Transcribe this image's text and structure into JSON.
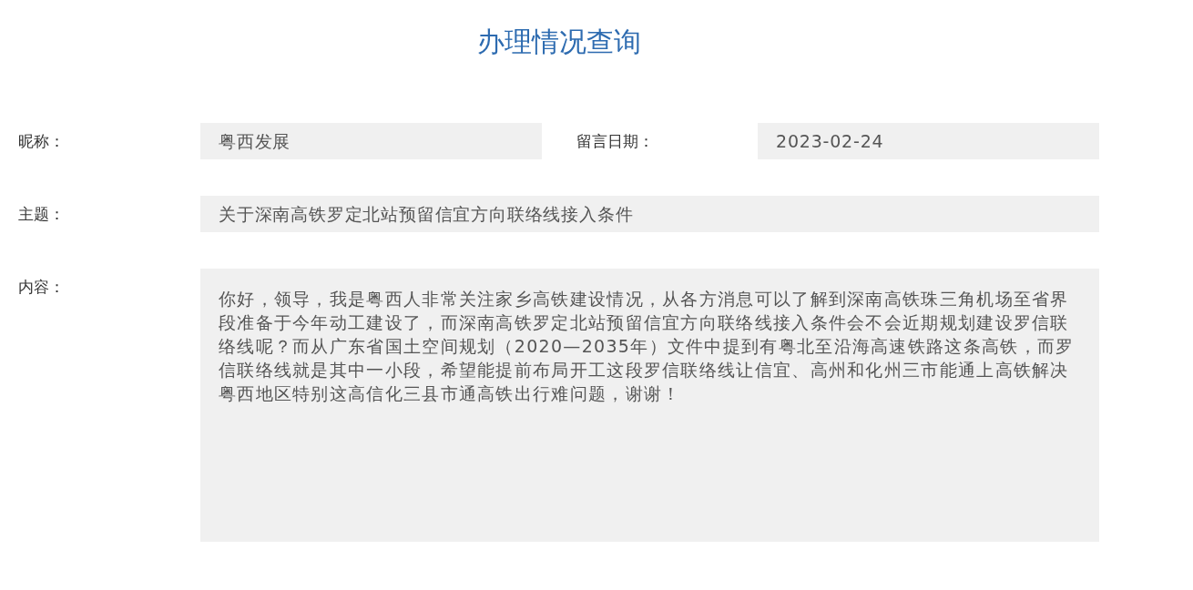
{
  "title": "办理情况查询",
  "rows": [
    {
      "fields": [
        {
          "kind": "line",
          "label": "昵称：",
          "value": "粤西发展"
        },
        {
          "kind": "line",
          "label": "留言日期：",
          "value": "2023-02-24"
        }
      ]
    },
    {
      "fields": [
        {
          "kind": "line",
          "label": "主题：",
          "value": "关于深南高铁罗定北站预留信宜方向联络线接入条件"
        }
      ]
    },
    {
      "fields": [
        {
          "kind": "area",
          "label": "内容：",
          "value": "你好，领导，我是粤西人非常关注家乡高铁建设情况，从各方消息可以了解到深南高铁珠三角机场至省界段准备于今年动工建设了，而深南高铁罗定北站预留信宜方向联络线接入条件会不会近期规划建设罗信联络线呢？而从广东省国土空间规划（2020—2035年）文件中提到有粤北至沿海高速铁路这条高铁，而罗信联络线就是其中一小段，希望能提前布局开工这段罗信联络线让信宜、高州和化州三市能通上高铁解决粤西地区特别这高信化三县市通高铁出行难问题，谢谢！"
        }
      ]
    }
  ]
}
